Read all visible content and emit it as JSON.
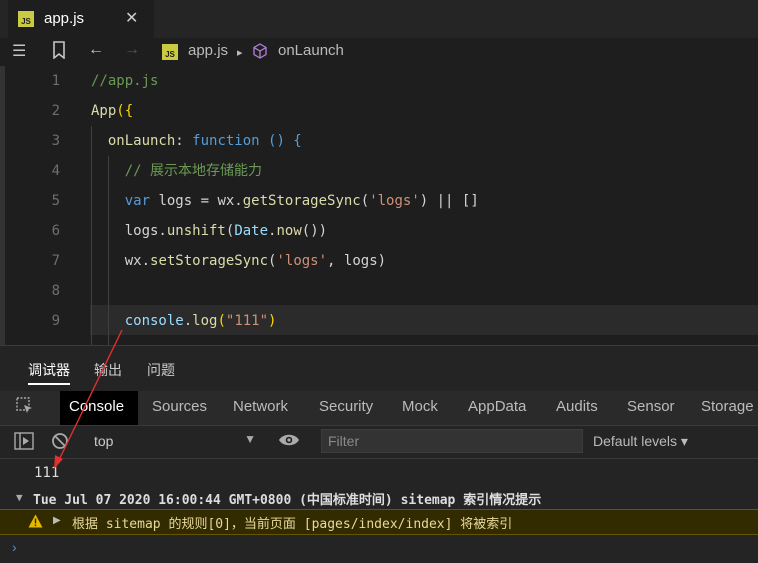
{
  "editor": {
    "tab": {
      "label": "app.js",
      "badge": "JS",
      "close": "✕"
    },
    "breadcrumb": {
      "file": "app.js",
      "separator": "▸",
      "symbol": "onLaunch"
    },
    "lines": [
      {
        "n": "1",
        "tokens": [
          {
            "t": "//app.js",
            "c": "t-cm"
          }
        ]
      },
      {
        "n": "2",
        "tokens": [
          {
            "t": "App",
            "c": "t-fn"
          },
          {
            "t": "({",
            "c": "t-br"
          }
        ]
      },
      {
        "n": "3",
        "tokens": [
          {
            "t": "  onLaunch",
            "c": "t-fn"
          },
          {
            "t": ": ",
            "c": ""
          },
          {
            "t": "function",
            "c": "t-kw"
          },
          {
            "t": " () {",
            "c": "t-kw"
          }
        ]
      },
      {
        "n": "4",
        "tokens": [
          {
            "t": "    // 展示本地存储能力",
            "c": "t-cm"
          }
        ]
      },
      {
        "n": "5",
        "tokens": [
          {
            "t": "    var",
            "c": "t-kw"
          },
          {
            "t": " logs = wx.",
            "c": ""
          },
          {
            "t": "getStorageSync",
            "c": "t-fn"
          },
          {
            "t": "(",
            "c": ""
          },
          {
            "t": "'logs'",
            "c": "t-str"
          },
          {
            "t": ") || []",
            "c": ""
          }
        ]
      },
      {
        "n": "6",
        "tokens": [
          {
            "t": "    logs.",
            "c": ""
          },
          {
            "t": "unshift",
            "c": "t-fn"
          },
          {
            "t": "(",
            "c": ""
          },
          {
            "t": "Date",
            "c": "t-prop"
          },
          {
            "t": ".",
            "c": ""
          },
          {
            "t": "now",
            "c": "t-fn"
          },
          {
            "t": "())",
            "c": ""
          }
        ]
      },
      {
        "n": "7",
        "tokens": [
          {
            "t": "    wx.",
            "c": ""
          },
          {
            "t": "setStorageSync",
            "c": "t-fn"
          },
          {
            "t": "(",
            "c": ""
          },
          {
            "t": "'logs'",
            "c": "t-str"
          },
          {
            "t": ", logs)",
            "c": ""
          }
        ]
      },
      {
        "n": "8",
        "tokens": [
          {
            "t": "",
            "c": ""
          }
        ]
      },
      {
        "n": "9",
        "tokens": [
          {
            "t": "    console",
            "c": "t-prop"
          },
          {
            "t": ".",
            "c": ""
          },
          {
            "t": "log",
            "c": "t-fn"
          },
          {
            "t": "(",
            "c": "t-br"
          },
          {
            "t": "\"111\"",
            "c": "t-str"
          },
          {
            "t": ")",
            "c": "t-br"
          }
        ]
      }
    ]
  },
  "panel": {
    "tabs": [
      "调试器",
      "输出",
      "问题"
    ],
    "devtools_tabs": [
      "Console",
      "Sources",
      "Network",
      "Security",
      "Mock",
      "AppData",
      "Audits",
      "Sensor",
      "Storage"
    ],
    "context": "top",
    "filter_placeholder": "Filter",
    "levels": "Default levels ▾",
    "log_output": "111",
    "group_header": "Tue Jul 07 2020 16:00:44 GMT+0800 (中国标准时间) sitemap 索引情况提示",
    "warning": "根据 sitemap 的规则[0]，当前页面 [pages/index/index] 将被索引",
    "prompt": "›"
  },
  "colors": {
    "accent": "#4a8fe7",
    "warning_bg": "#332b00",
    "arrow": "#e03030"
  }
}
